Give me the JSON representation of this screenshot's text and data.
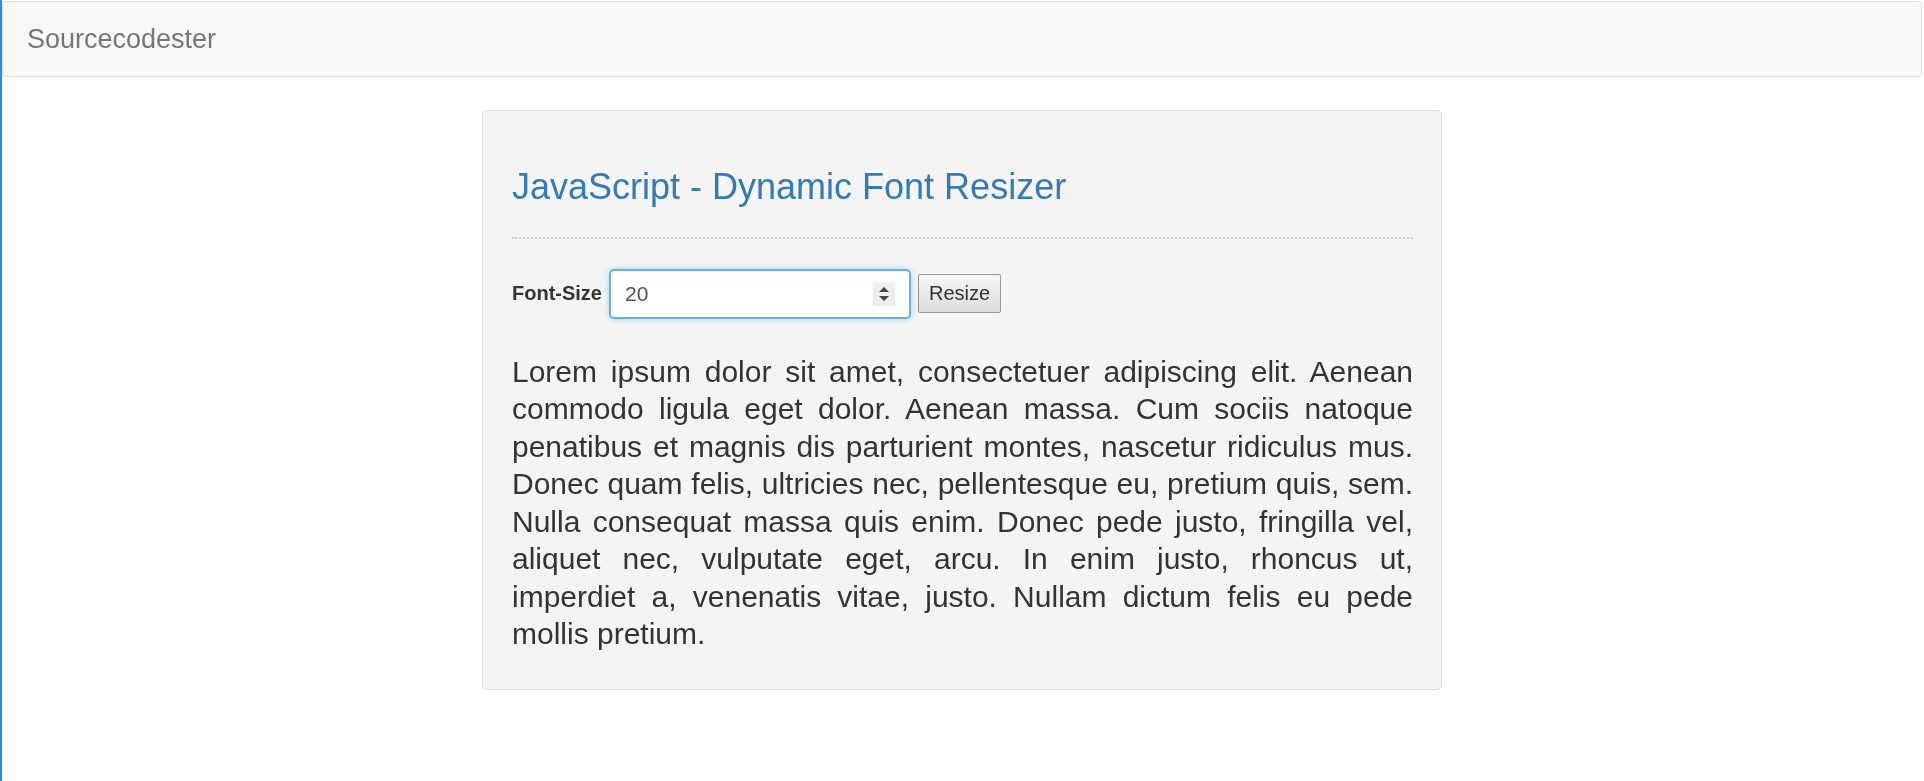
{
  "navbar": {
    "brand": "Sourcecodester"
  },
  "card": {
    "title": "JavaScript - Dynamic Font Resizer",
    "form": {
      "label": "Font-Size",
      "value": "20",
      "button": "Resize"
    },
    "paragraph": "Lorem ipsum dolor sit amet, consectetuer adipiscing elit. Aenean commodo ligula eget dolor. Aenean massa. Cum sociis natoque penatibus et magnis dis parturient montes, nascetur ridiculus mus. Donec quam felis, ultricies nec, pellentesque eu, pretium quis, sem. Nulla consequat massa quis enim. Donec pede justo, fringilla vel, aliquet nec, vulputate eget, arcu. In enim justo, rhoncus ut, imperdiet a, venenatis vitae, justo. Nullam dictum felis eu pede mollis pretium."
  }
}
